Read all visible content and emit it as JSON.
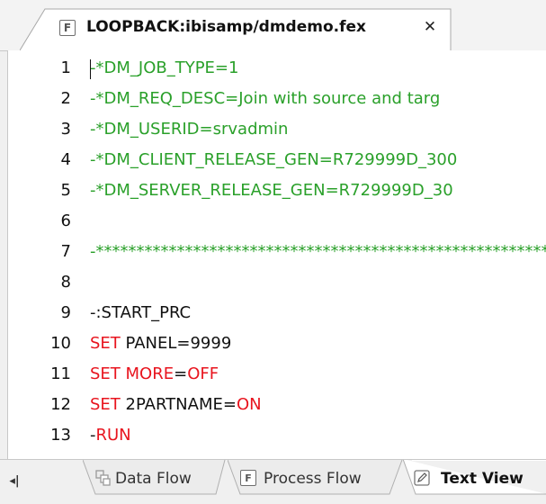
{
  "tab": {
    "icon": "F",
    "title": "LOOPBACK:ibisamp/dmdemo.fex",
    "close": "✕"
  },
  "editor": {
    "lines": [
      {
        "num": "1",
        "segments": [
          {
            "text": "-*DM_JOB_TYPE=1",
            "color": "green"
          }
        ]
      },
      {
        "num": "2",
        "segments": [
          {
            "text": "-*DM_REQ_DESC=Join with source and targ",
            "color": "green"
          }
        ]
      },
      {
        "num": "3",
        "segments": [
          {
            "text": "-*DM_USERID=srvadmin",
            "color": "green"
          }
        ]
      },
      {
        "num": "4",
        "segments": [
          {
            "text": "-*DM_CLIENT_RELEASE_GEN=R729999D_300",
            "color": "green"
          }
        ]
      },
      {
        "num": "5",
        "segments": [
          {
            "text": "-*DM_SERVER_RELEASE_GEN=R729999D_30",
            "color": "green"
          }
        ]
      },
      {
        "num": "6",
        "segments": []
      },
      {
        "num": "7",
        "segments": [
          {
            "text": "-*******************************************************************",
            "color": "green"
          }
        ]
      },
      {
        "num": "8",
        "segments": []
      },
      {
        "num": "9",
        "segments": [
          {
            "text": "-:START_PRC",
            "color": "black"
          }
        ]
      },
      {
        "num": "10",
        "segments": [
          {
            "text": "SET",
            "color": "red"
          },
          {
            "text": " PANEL=9999",
            "color": "black"
          }
        ]
      },
      {
        "num": "11",
        "segments": [
          {
            "text": "SET",
            "color": "red"
          },
          {
            "text": " ",
            "color": "black"
          },
          {
            "text": "MORE",
            "color": "red"
          },
          {
            "text": "=",
            "color": "black"
          },
          {
            "text": "OFF",
            "color": "red"
          }
        ]
      },
      {
        "num": "12",
        "segments": [
          {
            "text": "SET",
            "color": "red"
          },
          {
            "text": " 2PARTNAME=",
            "color": "black"
          },
          {
            "text": "ON",
            "color": "red"
          }
        ]
      },
      {
        "num": "13",
        "segments": [
          {
            "text": "-",
            "color": "black"
          },
          {
            "text": "RUN",
            "color": "red"
          }
        ]
      }
    ]
  },
  "bottom_tabs": {
    "nav_first": "◂|",
    "items": [
      {
        "label": "Data Flow",
        "icon": "data-flow-icon",
        "active": false
      },
      {
        "label": "Process Flow",
        "icon": "process-flow-icon",
        "icon_letter": "F",
        "active": false
      },
      {
        "label": "Text View",
        "icon": "text-view-icon",
        "active": true
      }
    ]
  },
  "colors": {
    "comment_green": "#2aa02a",
    "keyword_red": "#e8141e",
    "text": "#111111",
    "chrome_bg": "#f0f0f0"
  }
}
